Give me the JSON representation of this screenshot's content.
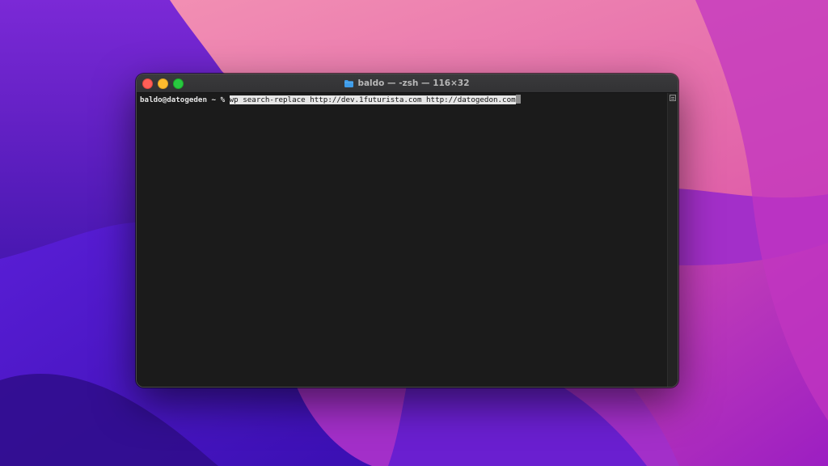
{
  "window": {
    "title": "baldo — -zsh — 116×32"
  },
  "terminal": {
    "prompt": "baldo@datogeden ~ % ",
    "command": "wp search-replace http://dev.1futurista.com http://datogedon.com"
  },
  "colors": {
    "close": "#ff5f57",
    "minimize": "#febc2e",
    "maximize": "#28c840",
    "terminal_bg": "#1b1b1b",
    "folder": "#3d9be9"
  },
  "icons": {
    "title_icon": "folder-icon",
    "scroll_icon": "split-pane-icon"
  }
}
